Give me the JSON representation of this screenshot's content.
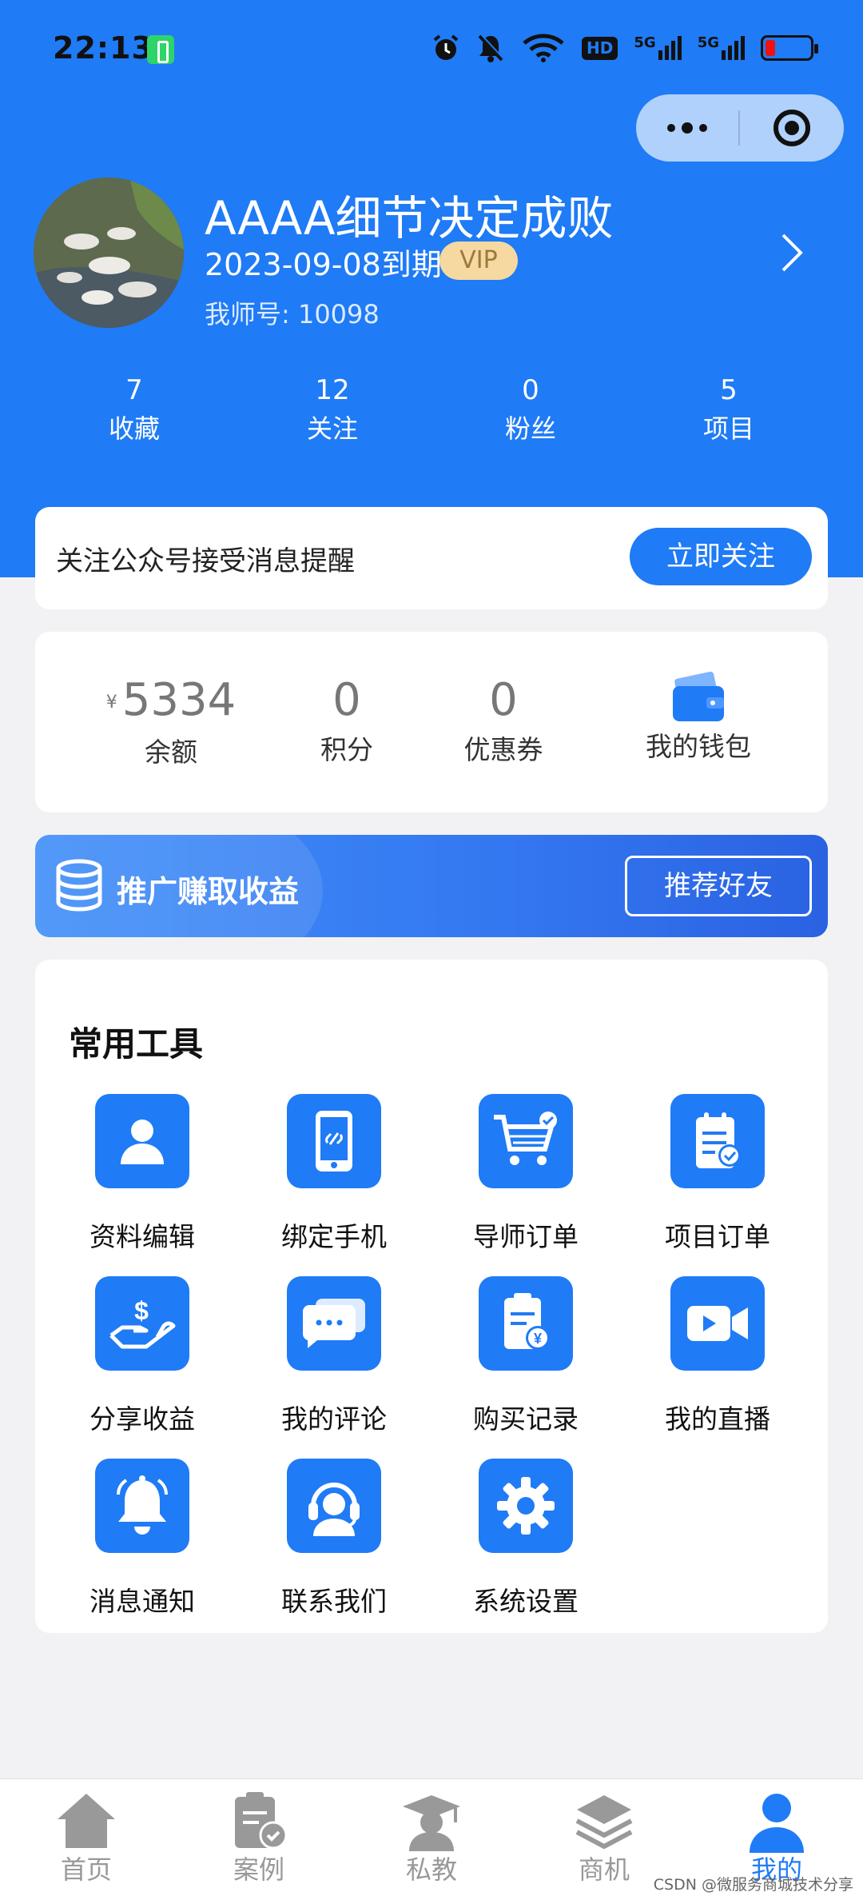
{
  "status_bar": {
    "time": "22:13",
    "hd_label": "HD",
    "net1": "5G",
    "net2": "5G"
  },
  "profile": {
    "name": "AAAA细节决定成败",
    "expiry": "2023-09-08到期",
    "vip": "VIP",
    "user_no": "我师号: 10098"
  },
  "stats": [
    {
      "value": "7",
      "label": "收藏"
    },
    {
      "value": "12",
      "label": "关注"
    },
    {
      "value": "0",
      "label": "粉丝"
    },
    {
      "value": "5",
      "label": "项目"
    }
  ],
  "follow": {
    "text": "关注公众号接受消息提醒",
    "button": "立即关注"
  },
  "wallet": {
    "currency": "¥",
    "balance": "5334",
    "balance_label": "余额",
    "points": "0",
    "points_label": "积分",
    "coupons": "0",
    "coupons_label": "优惠券",
    "wallet_label": "我的钱包"
  },
  "promo": {
    "text": "推广赚取收益",
    "button": "推荐好友"
  },
  "tools": {
    "title": "常用工具",
    "items": [
      {
        "label": "资料编辑",
        "icon": "user-icon"
      },
      {
        "label": "绑定手机",
        "icon": "phone-link-icon"
      },
      {
        "label": "导师订单",
        "icon": "cart-icon"
      },
      {
        "label": "项目订单",
        "icon": "clipboard-check-icon"
      },
      {
        "label": "分享收益",
        "icon": "dollar-hand-icon"
      },
      {
        "label": "我的评论",
        "icon": "chat-bubbles-icon"
      },
      {
        "label": "购买记录",
        "icon": "receipt-yen-icon"
      },
      {
        "label": "我的直播",
        "icon": "video-camera-icon"
      },
      {
        "label": "消息通知",
        "icon": "bell-icon"
      },
      {
        "label": "联系我们",
        "icon": "headset-icon"
      },
      {
        "label": "系统设置",
        "icon": "gear-icon"
      }
    ]
  },
  "tabbar": [
    {
      "label": "首页",
      "icon": "home-icon"
    },
    {
      "label": "案例",
      "icon": "case-icon"
    },
    {
      "label": "私教",
      "icon": "graduation-icon"
    },
    {
      "label": "商机",
      "icon": "layers-icon"
    },
    {
      "label": "我的",
      "icon": "profile-icon",
      "active": true
    }
  ],
  "watermark": "CSDN @微服务商城技术分享",
  "colors": {
    "primary": "#1f7bf6",
    "vip_bg": "#f5d9a0",
    "background": "#f2f2f4"
  }
}
